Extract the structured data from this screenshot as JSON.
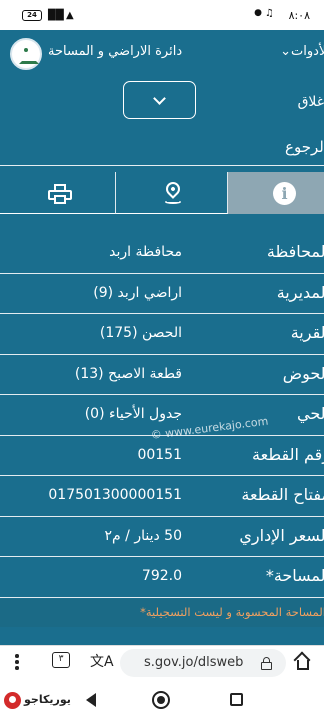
{
  "status_bar": {
    "time": "٨:٠٨",
    "battery": "24"
  },
  "header": {
    "department": "دائرة الاراضي و المساحة",
    "tools_label": "الأدوات",
    "close_label": "اغلاق",
    "back_label": "الرجوع"
  },
  "tabs": [
    {
      "name": "info",
      "icon": "info-icon",
      "active": true
    },
    {
      "name": "location",
      "icon": "location-pin-icon",
      "active": false
    },
    {
      "name": "print",
      "icon": "printer-icon",
      "active": false
    }
  ],
  "fields": [
    {
      "label": "المحافظة",
      "value": "محافظة اربد"
    },
    {
      "label": "المديرية",
      "value": "اراضي اربد (9)"
    },
    {
      "label": "القرية",
      "value": "الحصن (175)"
    },
    {
      "label": "الحوض",
      "value": "قطعة الاصبح (13)"
    },
    {
      "label": "الحي",
      "value": "جدول الأحياء (0)"
    },
    {
      "label": "رقم القطعة",
      "value": "00151"
    },
    {
      "label": "مفتاح القطعة",
      "value": "017501300000151"
    },
    {
      "label": "السعر الإداري",
      "value": "50 دينار / م٢"
    },
    {
      "label": "المساحة*",
      "value": "792.0"
    }
  ],
  "watermark": "© www.eurekajo.com",
  "footnote": "المساحة المحسوبة و ليست التسجيلية*",
  "browser": {
    "url": "s.gov.jo/dlsweb",
    "tab_count": "٣"
  },
  "brand": "يوريكاجو",
  "colors": {
    "app_bg": "#1a6e8e",
    "active_tab": "#8ea7b3",
    "note_text": "#f0a060"
  }
}
